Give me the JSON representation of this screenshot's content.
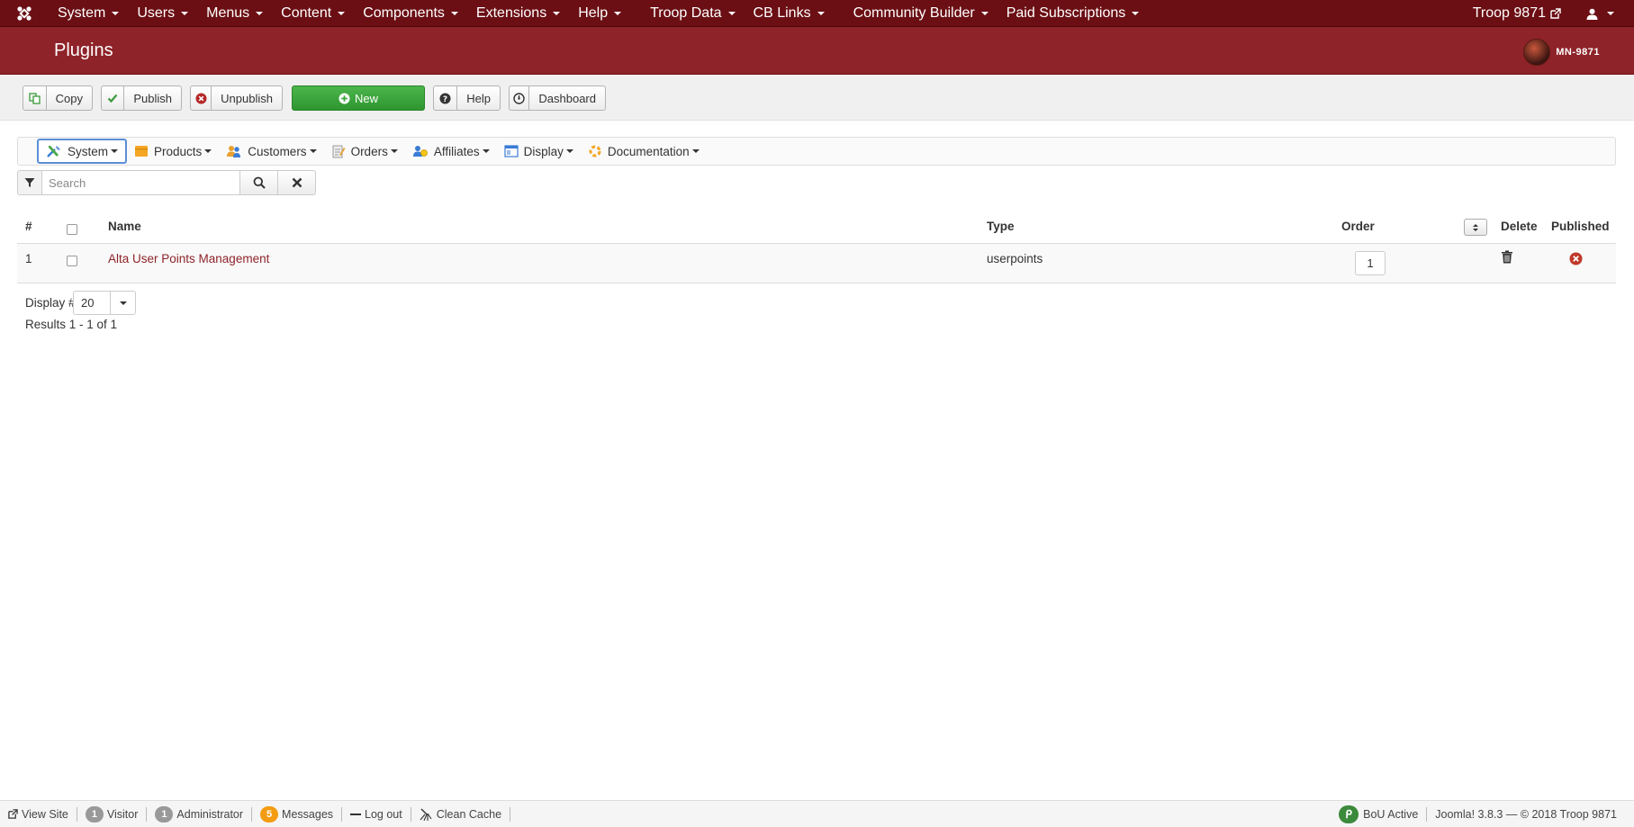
{
  "topnav": {
    "menus": [
      "System",
      "Users",
      "Menus",
      "Content",
      "Components",
      "Extensions",
      "Help",
      "Troop Data",
      "CB Links",
      "Community Builder",
      "Paid Subscriptions"
    ],
    "site_link": "Troop 9871"
  },
  "header": {
    "title": "Plugins",
    "brand": "MN-9871"
  },
  "toolbar": {
    "copy": "Copy",
    "publish": "Publish",
    "unpublish": "Unpublish",
    "new": "New",
    "help": "Help",
    "dashboard": "Dashboard"
  },
  "subnav": {
    "items": [
      "System",
      "Products",
      "Customers",
      "Orders",
      "Affiliates",
      "Display",
      "Documentation"
    ],
    "active": "System"
  },
  "search": {
    "placeholder": "Search"
  },
  "table": {
    "headers": {
      "num": "#",
      "name": "Name",
      "type": "Type",
      "order": "Order",
      "delete": "Delete",
      "published": "Published"
    },
    "rows": [
      {
        "num": "1",
        "name": "Alta User Points Management",
        "type": "userpoints",
        "order": "1"
      }
    ]
  },
  "pagination": {
    "display_label": "Display #",
    "display_value": "20",
    "results": "Results 1 - 1 of 1"
  },
  "footer": {
    "view_site": "View Site",
    "visitor_count": "1",
    "visitor": "Visitor",
    "admin_count": "1",
    "admin": "Administrator",
    "messages_count": "5",
    "messages": "Messages",
    "logout": "Log out",
    "clean_cache": "Clean Cache",
    "bou": "BoU Active",
    "version": "Joomla! 3.8.3",
    "copyright": "— © 2018 Troop 9871"
  },
  "colors": {
    "topnav": "#6b0f14",
    "header": "#8e2329",
    "new_button": "#3ba83b",
    "link": "#8e2329",
    "unpublished_icon": "#c0392b"
  }
}
